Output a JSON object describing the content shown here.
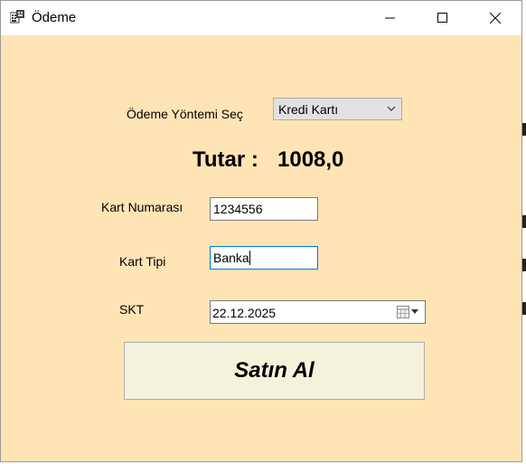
{
  "window": {
    "title": "Ödeme",
    "controls": {
      "minimize": "minimize",
      "maximize": "maximize",
      "close": "close"
    }
  },
  "form": {
    "payment_method_label": "Ödeme Yöntemi Seç",
    "payment_method_value": "Kredi Kartı",
    "amount_label": "Tutar :",
    "amount_value": "1008,0",
    "card_number_label": "Kart Numarası",
    "card_number_value": "1234556",
    "card_type_label": "Kart Tipi",
    "card_type_value": "Banka",
    "expiry_label": "SKT",
    "expiry_value": "22.12.2025",
    "buy_button_label": "Satın Al"
  },
  "icons": {
    "app": "app-icon",
    "dropdown": "chevron-down-icon",
    "calendar": "calendar-icon"
  },
  "colors": {
    "form_background": "#ffe4b5",
    "button_background": "#f5f2dc",
    "focus_border": "#0078d7"
  }
}
